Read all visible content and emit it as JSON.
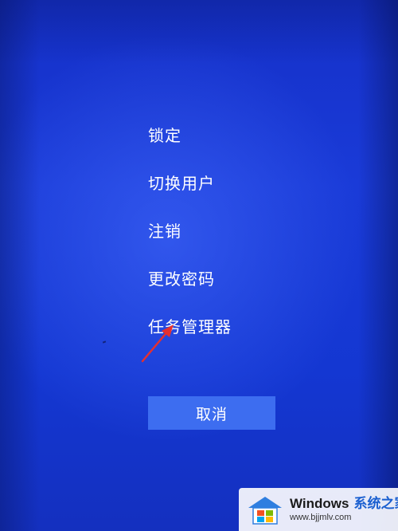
{
  "menu": {
    "items": [
      {
        "label": "锁定"
      },
      {
        "label": "切换用户"
      },
      {
        "label": "注销"
      },
      {
        "label": "更改密码"
      },
      {
        "label": "任务管理器"
      }
    ]
  },
  "cancel": {
    "label": "取消"
  },
  "colors": {
    "background": "#1a3bd8",
    "button": "#3d6df0",
    "text": "#ffffff",
    "annotation_arrow": "#e53030"
  },
  "watermark": {
    "brand": "Windows",
    "brand_cn": "系统之家",
    "url": "www.bjjmlv.com"
  }
}
